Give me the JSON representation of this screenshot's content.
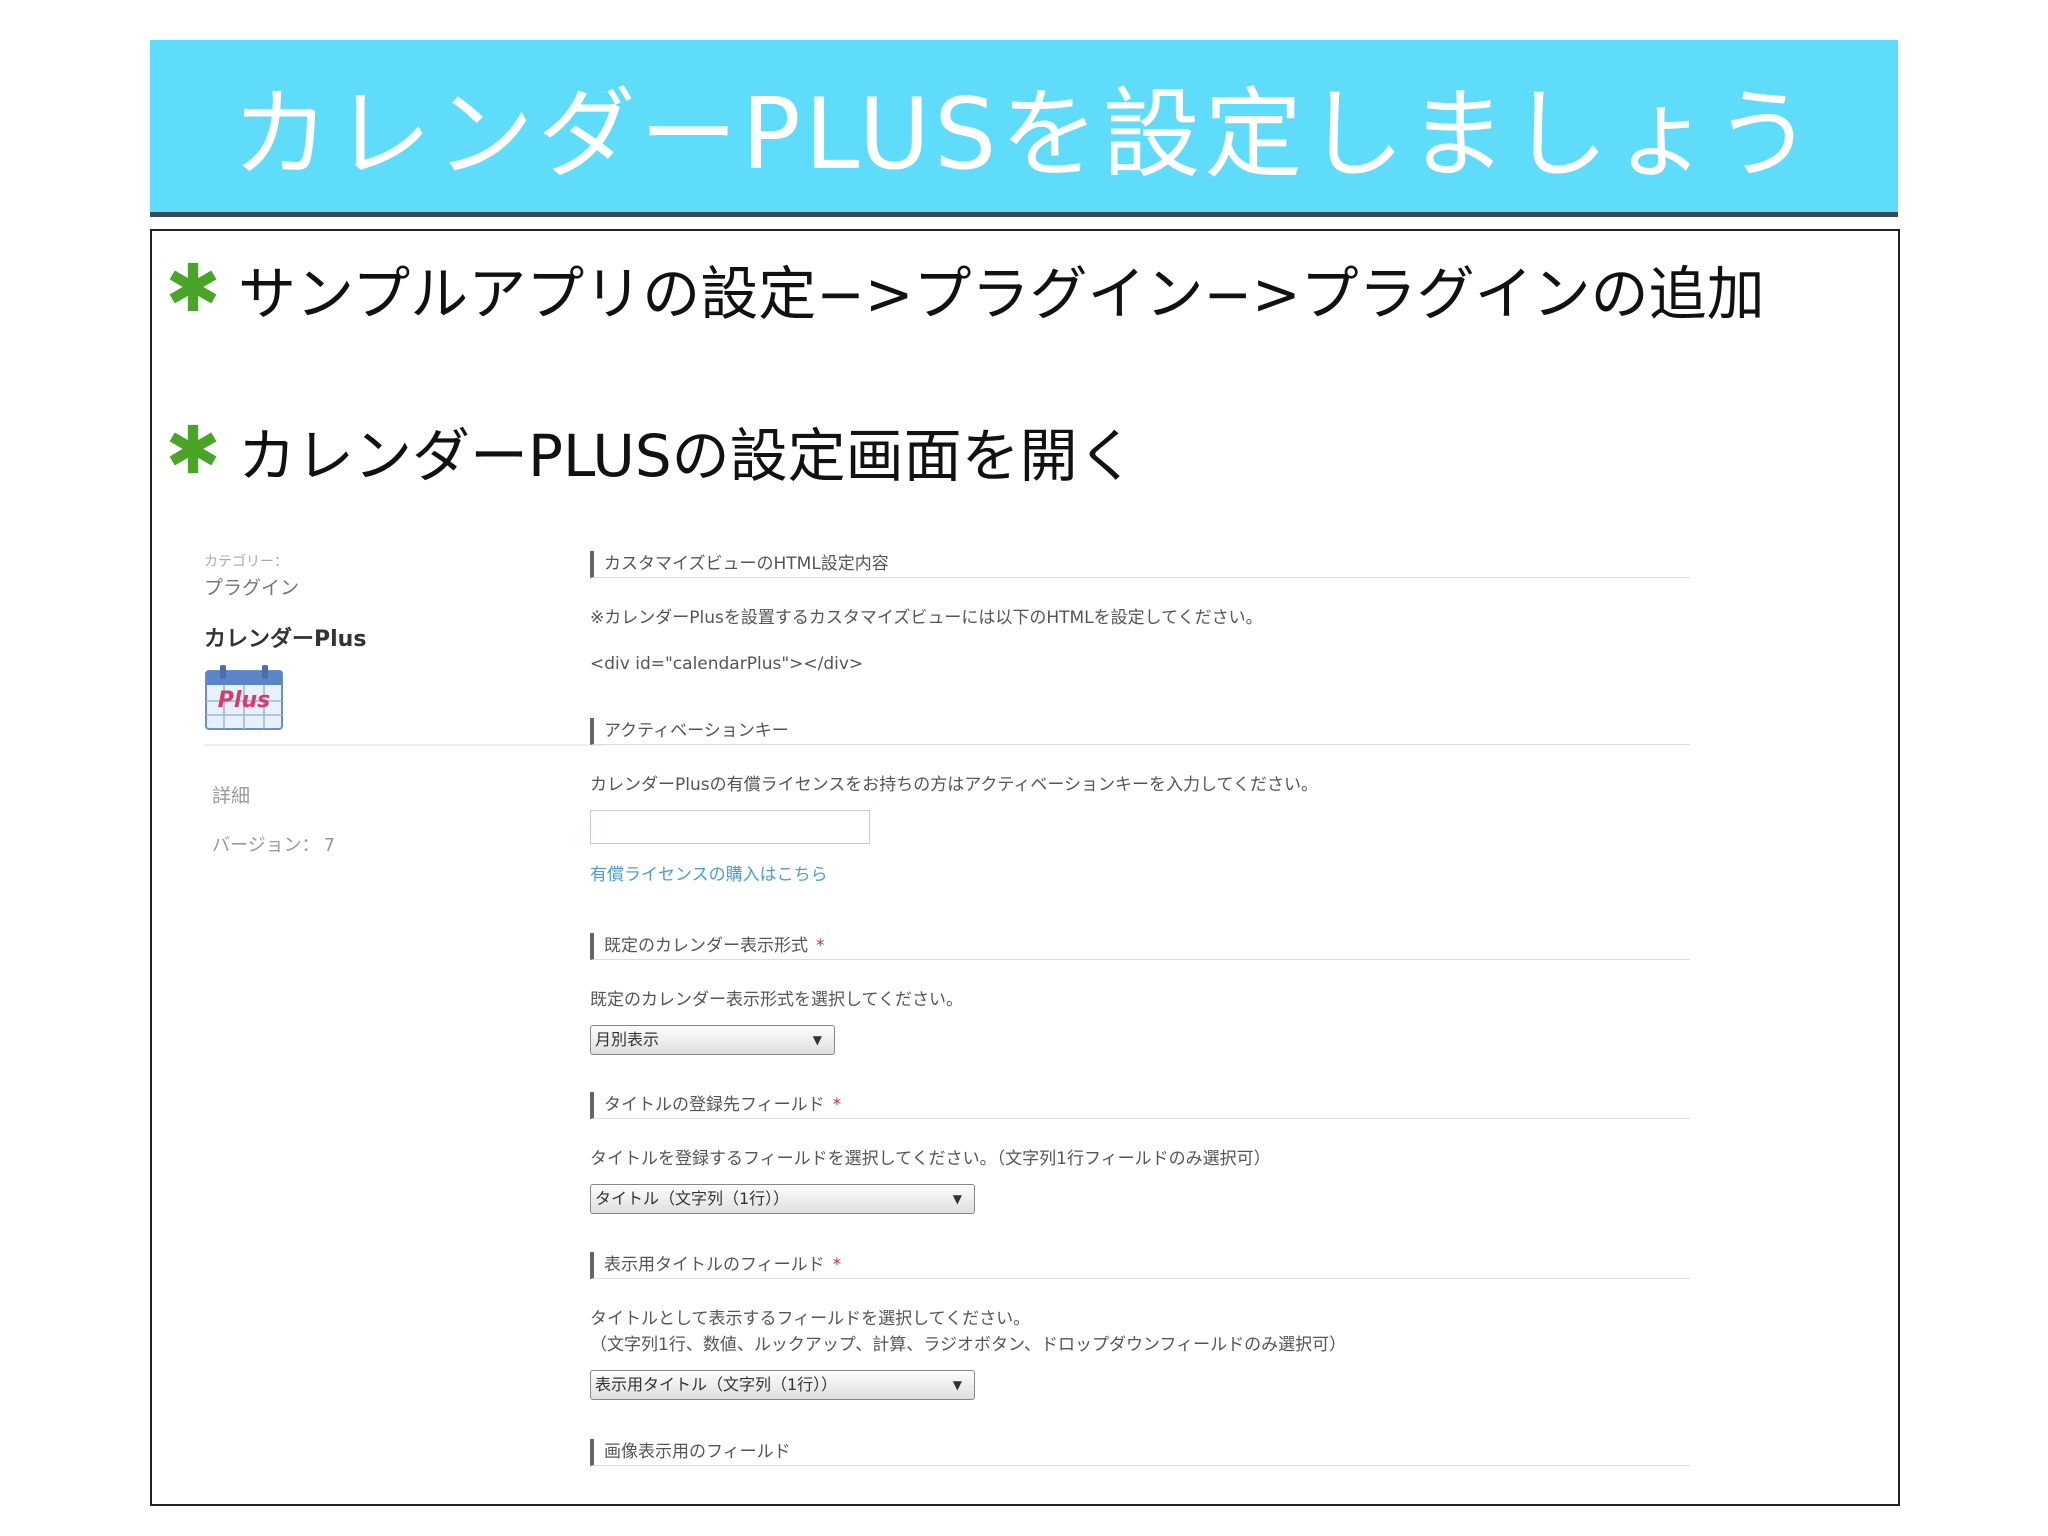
{
  "slide": {
    "title": "カレンダーPLUSを設定しましょう",
    "bullet_symbol": "✱",
    "bullets": [
      "サンプルアプリの設定−>プラグイン−>プラグインの追加",
      "カレンダーPLUSの設定画面を開く"
    ]
  },
  "sidebar": {
    "category_label": "カテゴリー：",
    "category_value": "プラグイン",
    "plugin_name": "カレンダーPlus",
    "icon_text": "Plus",
    "detail_label": "詳細",
    "version_label": "バージョン：",
    "version_value": "7"
  },
  "settings": {
    "html_section": {
      "heading": "カスタマイズビューのHTML設定内容",
      "note": "※カレンダーPlusを設置するカスタマイズビューには以下のHTMLを設定してください。",
      "code": "<div id=\"calendarPlus\"></div>"
    },
    "activation_section": {
      "heading": "アクティベーションキー",
      "description": "カレンダーPlusの有償ライセンスをお持ちの方はアクティベーションキーを入力してください。",
      "input_value": "",
      "purchase_link": "有償ライセンスの購入はこちら"
    },
    "display_format_section": {
      "heading": "既定のカレンダー表示形式",
      "required_mark": "*",
      "description": "既定のカレンダー表示形式を選択してください。",
      "selected": "月別表示"
    },
    "title_field_section": {
      "heading": "タイトルの登録先フィールド",
      "required_mark": "*",
      "description": "タイトルを登録するフィールドを選択してください。（文字列1行フィールドのみ選択可）",
      "selected": "タイトル（文字列（1行））"
    },
    "display_title_section": {
      "heading": "表示用タイトルのフィールド",
      "required_mark": "*",
      "description_line1": "タイトルとして表示するフィールドを選択してください。",
      "description_line2": "（文字列1行、数値、ルックアップ、計算、ラジオボタン、ドロップダウンフィールドのみ選択可）",
      "selected": "表示用タイトル（文字列（1行））"
    },
    "image_section": {
      "heading": "画像表示用のフィールド"
    }
  },
  "colors": {
    "title_bar": "#5fdcf9",
    "bullet_star": "#4aa526",
    "link": "#4a9ed9"
  }
}
